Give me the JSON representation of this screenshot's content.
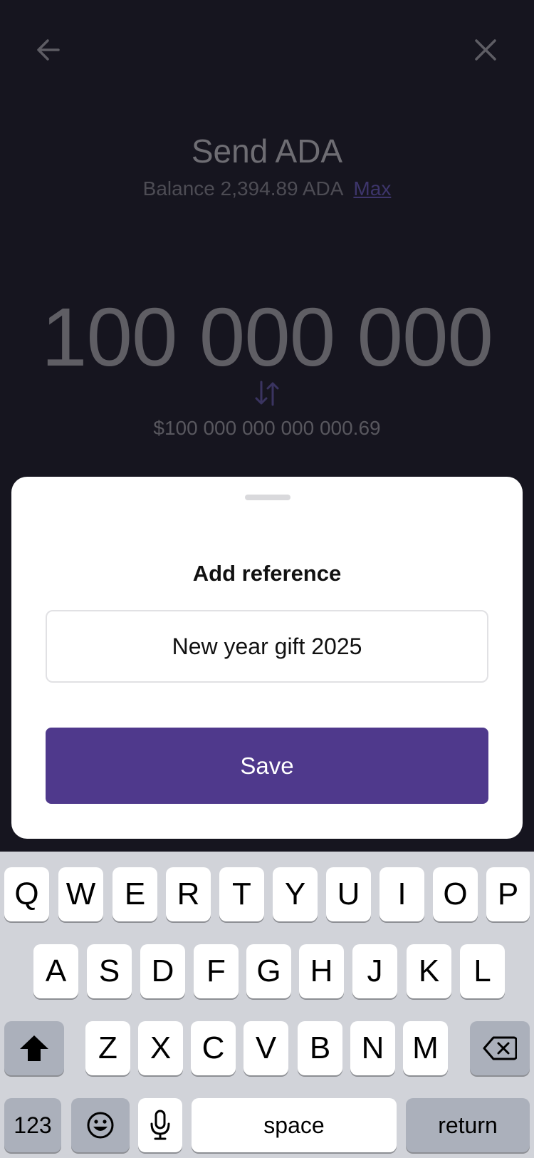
{
  "header": {
    "back_icon": "arrow-left-icon",
    "close_icon": "close-icon",
    "title": "Send ADA",
    "balance_text": "Balance 2,394.89 ADA",
    "max_label": "Max"
  },
  "amount": {
    "value": "100 000 000",
    "swap_icon": "swap-arrows-icon",
    "fiat_value": "$100 000 000 000 000.69"
  },
  "sheet": {
    "title": "Add reference",
    "reference_value": "New year gift 2025",
    "save_label": "Save"
  },
  "keyboard": {
    "row1": [
      "Q",
      "W",
      "E",
      "R",
      "T",
      "Y",
      "U",
      "I",
      "O",
      "P"
    ],
    "row2": [
      "A",
      "S",
      "D",
      "F",
      "G",
      "H",
      "J",
      "K",
      "L"
    ],
    "row3": [
      "Z",
      "X",
      "C",
      "V",
      "B",
      "N",
      "M"
    ],
    "shift_icon": "shift-icon",
    "backspace_icon": "backspace-icon",
    "numbers_label": "123",
    "emoji_icon": "emoji-icon",
    "mic_icon": "microphone-icon",
    "space_label": "space",
    "return_label": "return"
  },
  "colors": {
    "background": "#16151f",
    "accent": "#4f398c",
    "keyboard_bg": "#d1d3d9"
  }
}
